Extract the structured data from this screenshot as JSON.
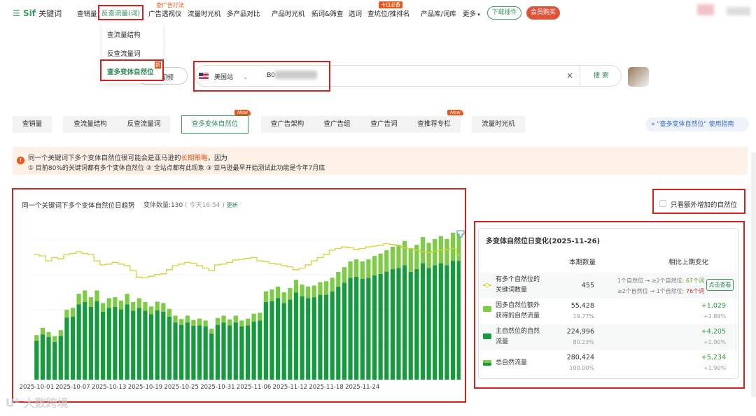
{
  "topnav": {
    "logo": "Sif",
    "logo_sub": "关键词",
    "items": [
      {
        "label": "查销量"
      },
      {
        "label": "反查流量(词)"
      },
      {
        "label": "广告透视仪"
      },
      {
        "label": "流量时光机"
      },
      {
        "label": "多产品对比"
      },
      {
        "label": "产品时光机"
      },
      {
        "label": "拓词&筛查"
      },
      {
        "label": "选词"
      },
      {
        "label": "查坑位/推排名"
      },
      {
        "label": "产品库/词库"
      },
      {
        "label": "更多"
      }
    ],
    "tag_ad": "查广告打法",
    "tag_must": "卡位必备",
    "download": "下载插件",
    "vip": "会员购买"
  },
  "dropdown": {
    "items": [
      "查流量结构",
      "反查流量词",
      "查多变体自然位"
    ],
    "new_badge": "新"
  },
  "search": {
    "video": "视频",
    "site": "美国站",
    "value": "B0",
    "button": "搜 索"
  },
  "tabs": [
    {
      "label": "查销量"
    },
    {
      "label": "查流量结构"
    },
    {
      "label": "反查流量词"
    },
    {
      "label": "查多变体自然位"
    },
    {
      "label": "查广告架构"
    },
    {
      "label": "查广告组"
    },
    {
      "label": "查广告词"
    },
    {
      "label": "查推荐专栏"
    },
    {
      "label": "流量时光机"
    }
  ],
  "tab_new": "New",
  "guide": "\"查多变体自然位\" 使用指南",
  "notice": {
    "line1_a": "同一个关键词下多个变体自然位很可能会是亚马逊的",
    "line1_b": "长期策略",
    "line1_c": "，因为",
    "line2": "① 目前80%的关键词都有多个变体自然位 ② 全站点都有此现象 ③ 亚马逊最早开始测试此功能是今年7月底"
  },
  "chart_header": {
    "title": "同一个关键词下多个变体自然位日趋势",
    "meta_a": "变体数量:130",
    "meta_b": "( 今天16:54 )",
    "update": "更新"
  },
  "checkbox_label": "只看额外增加的自然位",
  "panel": {
    "title": "多变体自然位日变化(2025-11-26)",
    "col_current": "本期数量",
    "col_change": "相比上期变化",
    "rows": [
      {
        "label1": "有多个自然位的",
        "label2": "关键词数量",
        "value": "455",
        "pct": "",
        "change": "",
        "change_pct": ""
      },
      {
        "label1": "因多自然位额外",
        "label2": "获得的自然流量",
        "value": "55,428",
        "pct": "19.77%",
        "change": "+1,029",
        "change_pct": "+1.89%"
      },
      {
        "label1": "主自然位的自然",
        "label2": "流量",
        "value": "224,996",
        "pct": "80.23%",
        "change": "+4,205",
        "change_pct": "+1.90%"
      },
      {
        "label1": "总自然流量",
        "label2": "",
        "value": "280,424",
        "pct": "100.00%",
        "change": "+5,234",
        "change_pct": "+1.90%"
      }
    ],
    "desc1_a": "1个自然位 → ≥2个自然位: ",
    "desc1_b": "67个词",
    "desc2_a": "≥2个自然位 → 1个自然位: ",
    "desc2_b": "76个词",
    "view_button": "点击查看"
  },
  "watermark": "大数跨境",
  "colors": {
    "brand_green": "#2e8b57",
    "bar_dark": "#159b3d",
    "bar_light": "#7dcc45",
    "line_yellow": "#d6d23a",
    "annotation_red": "#d62020",
    "accent_orange": "#e8561a"
  },
  "chart_data": {
    "type": "bar",
    "x_ticks": [
      "2025-10-01",
      "2025-10-07",
      "2025-10-13",
      "2025-10-19",
      "2025-10-25",
      "2025-10-31",
      "2025-11-06",
      "2025-11-12",
      "2025-11-18",
      "2025-11-24"
    ],
    "series": [
      {
        "values": [
          80,
          93,
          88,
          78,
          90,
          128,
          130,
          155,
          160,
          150,
          162,
          140,
          148,
          150,
          145,
          155,
          142,
          148,
          142,
          135,
          143,
          140,
          130,
          118,
          113,
          118,
          111,
          112,
          110,
          95,
          113,
          118,
          112,
          118,
          110,
          112,
          120,
          122,
          160,
          162,
          168,
          158,
          165,
          180,
          172,
          168,
          170,
          175,
          175,
          182,
          192,
          200,
          210,
          212,
          208,
          210,
          215,
          218,
          223,
          228,
          230,
          236,
          222,
          228,
          240,
          230,
          236,
          240,
          236,
          245,
          245
        ]
      },
      {
        "values": [
          12,
          14,
          10,
          12,
          12,
          16,
          18,
          22,
          24,
          20,
          22,
          18,
          20,
          20,
          18,
          22,
          18,
          20,
          18,
          16,
          18,
          18,
          16,
          14,
          12,
          14,
          12,
          14,
          12,
          10,
          14,
          14,
          12,
          14,
          12,
          14,
          16,
          16,
          22,
          24,
          24,
          22,
          24,
          26,
          24,
          24,
          24,
          26,
          28,
          28,
          30,
          32,
          34,
          36,
          36,
          38,
          40,
          42,
          44,
          46,
          48,
          50,
          48,
          50,
          54,
          52,
          54,
          56,
          54,
          58,
          60
        ]
      },
      {
        "values": [
          455,
          452,
          440,
          448,
          445,
          455,
          458,
          462,
          458,
          455,
          440,
          430,
          432,
          436,
          432,
          428,
          416,
          400,
          398,
          402,
          406,
          408,
          418,
          428,
          432,
          436,
          434,
          428,
          422,
          416,
          430,
          432,
          436,
          442,
          444,
          446,
          448,
          440,
          438,
          434,
          432,
          428,
          425,
          418,
          422,
          430,
          440,
          448,
          456,
          466,
          470,
          474,
          472,
          468,
          470,
          474,
          476,
          478,
          482,
          480,
          476,
          472,
          470,
          466,
          462,
          460,
          464,
          466,
          468,
          470,
          455
        ]
      }
    ]
  }
}
